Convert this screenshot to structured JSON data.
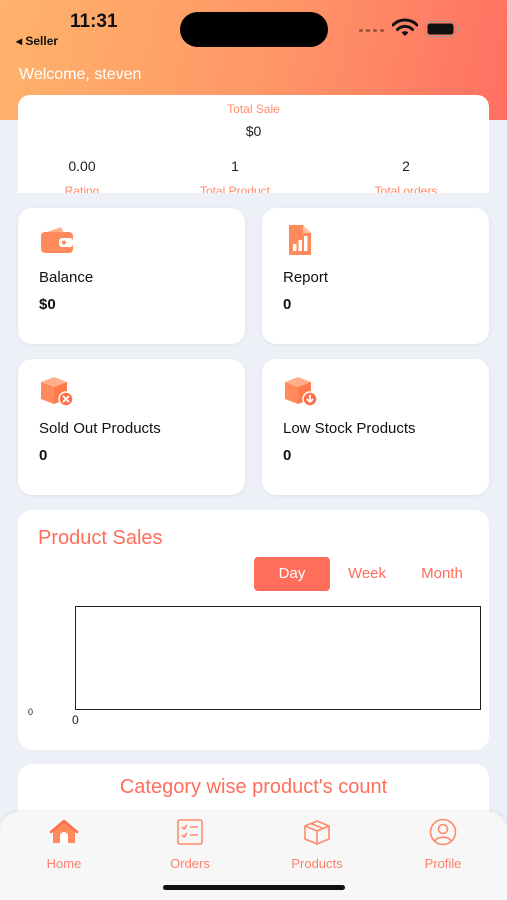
{
  "status_bar": {
    "time": "11:31",
    "back_app": "◂ Seller"
  },
  "header": {
    "welcome": "Welcome, steven"
  },
  "summary": {
    "total_sale_label": "Total Sale",
    "total_sale_value": "$0",
    "stats": [
      {
        "value": "0.00",
        "label": "Rating"
      },
      {
        "value": "1",
        "label": "Total Product"
      },
      {
        "value": "2",
        "label": "Total orders"
      }
    ]
  },
  "cards": [
    {
      "title": "Balance",
      "value": "$0",
      "icon": "wallet-icon"
    },
    {
      "title": "Report",
      "value": "0",
      "icon": "report-icon"
    },
    {
      "title": "Sold Out Products",
      "value": "0",
      "icon": "sold-out-box-icon"
    },
    {
      "title": "Low Stock Products",
      "value": "0",
      "icon": "low-stock-box-icon"
    }
  ],
  "product_sales": {
    "title": "Product Sales",
    "periods": [
      "Day",
      "Week",
      "Month"
    ],
    "selected_period": "Day"
  },
  "chart_data": {
    "type": "line",
    "title": "Product Sales",
    "series": [],
    "y_tick_labels": [
      "0"
    ],
    "x_tick_labels": [
      "0"
    ]
  },
  "category": {
    "title": "Category wise product's count"
  },
  "tabs": [
    {
      "label": "Home",
      "icon": "home-icon"
    },
    {
      "label": "Orders",
      "icon": "orders-icon"
    },
    {
      "label": "Products",
      "icon": "products-icon"
    },
    {
      "label": "Profile",
      "icon": "profile-icon"
    }
  ],
  "colors": {
    "accent": "#ff6e5a",
    "label_orange": "#ff8a6a",
    "gradient_start": "#ffb36b",
    "gradient_end": "#ff7062",
    "icon_orange": "#ff8a5c"
  }
}
